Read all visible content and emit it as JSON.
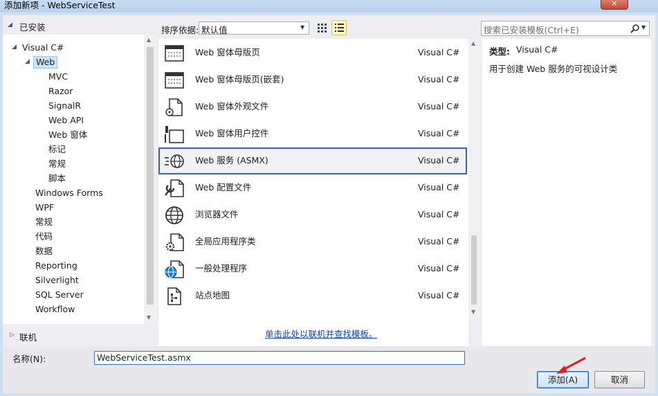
{
  "window": {
    "title": "添加新项 - WebServiceTest",
    "close_label": "✕"
  },
  "left": {
    "installed_label": "已安装",
    "tree": [
      {
        "label": "Visual C#",
        "indent": 0,
        "expanded": true
      },
      {
        "label": "Web",
        "indent": 1,
        "selected": true,
        "expanded": true
      },
      {
        "label": "MVC",
        "indent": 2
      },
      {
        "label": "Razor",
        "indent": 2
      },
      {
        "label": "SignalR",
        "indent": 2
      },
      {
        "label": "Web API",
        "indent": 2
      },
      {
        "label": "Web 窗体",
        "indent": 2
      },
      {
        "label": "标记",
        "indent": 2
      },
      {
        "label": "常规",
        "indent": 2
      },
      {
        "label": "脚本",
        "indent": 2
      },
      {
        "label": "Windows Forms",
        "indent": 1
      },
      {
        "label": "WPF",
        "indent": 1
      },
      {
        "label": "常规",
        "indent": 1
      },
      {
        "label": "代码",
        "indent": 1
      },
      {
        "label": "数据",
        "indent": 1
      },
      {
        "label": "Reporting",
        "indent": 1
      },
      {
        "label": "Silverlight",
        "indent": 1
      },
      {
        "label": "SQL Server",
        "indent": 1
      },
      {
        "label": "Workflow",
        "indent": 1
      }
    ],
    "online_label": "联机"
  },
  "sort": {
    "label": "排序依据:",
    "value": "默认值"
  },
  "templates": [
    {
      "name": "Web 窗体母版页",
      "lang": "Visual C#",
      "icon": "master-page-icon"
    },
    {
      "name": "Web 窗体母版页(嵌套)",
      "lang": "Visual C#",
      "icon": "nested-master-page-icon"
    },
    {
      "name": "Web 窗体外观文件",
      "lang": "Visual C#",
      "icon": "skin-file-icon"
    },
    {
      "name": "Web 窗体用户控件",
      "lang": "Visual C#",
      "icon": "user-control-icon"
    },
    {
      "name": "Web 服务 (ASMX)",
      "lang": "Visual C#",
      "icon": "web-service-icon",
      "selected": true
    },
    {
      "name": "Web 配置文件",
      "lang": "Visual C#",
      "icon": "config-file-icon"
    },
    {
      "name": "浏览器文件",
      "lang": "Visual C#",
      "icon": "browser-file-icon"
    },
    {
      "name": "全局应用程序类",
      "lang": "Visual C#",
      "icon": "global-class-icon"
    },
    {
      "name": "一般处理程序",
      "lang": "Visual C#",
      "icon": "generic-handler-icon"
    },
    {
      "name": "站点地图",
      "lang": "Visual C#",
      "icon": "sitemap-icon"
    }
  ],
  "online_link": "单击此处以联机并查找模板。",
  "search": {
    "placeholder": "搜索已安装模板(Ctrl+E)"
  },
  "details": {
    "type_label": "类型:",
    "type_value": "Visual C#",
    "description": "用于创建 Web 服务的可视设计类"
  },
  "name_field": {
    "label": "名称(N):",
    "value": "WebServiceTest.asmx"
  },
  "buttons": {
    "add": "添加(A)",
    "cancel": "取消"
  },
  "colors": {
    "selection_border": "#3a5fc0",
    "link": "#0b3fc4",
    "annotation_arrow": "#e02020"
  }
}
